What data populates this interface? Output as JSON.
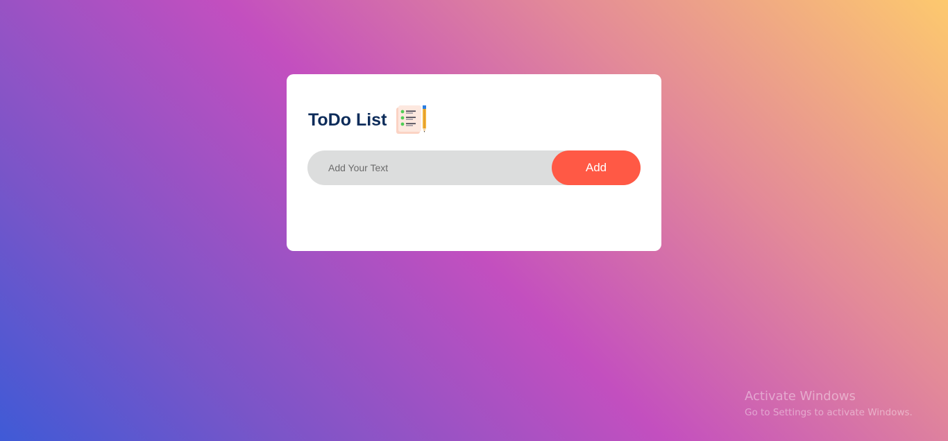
{
  "todo_app": {
    "title": "ToDo List",
    "title_icon": "checklist-with-pencil-icon",
    "input": {
      "placeholder": "Add Your Text",
      "value": ""
    },
    "add_button_label": "Add"
  },
  "colors": {
    "title": "#0d2c5a",
    "button": "#ff5945",
    "input_background": "#dcdddd",
    "card_background": "#ffffff"
  },
  "os_watermark": {
    "title": "Activate Windows",
    "subtitle": "Go to Settings to activate Windows."
  }
}
